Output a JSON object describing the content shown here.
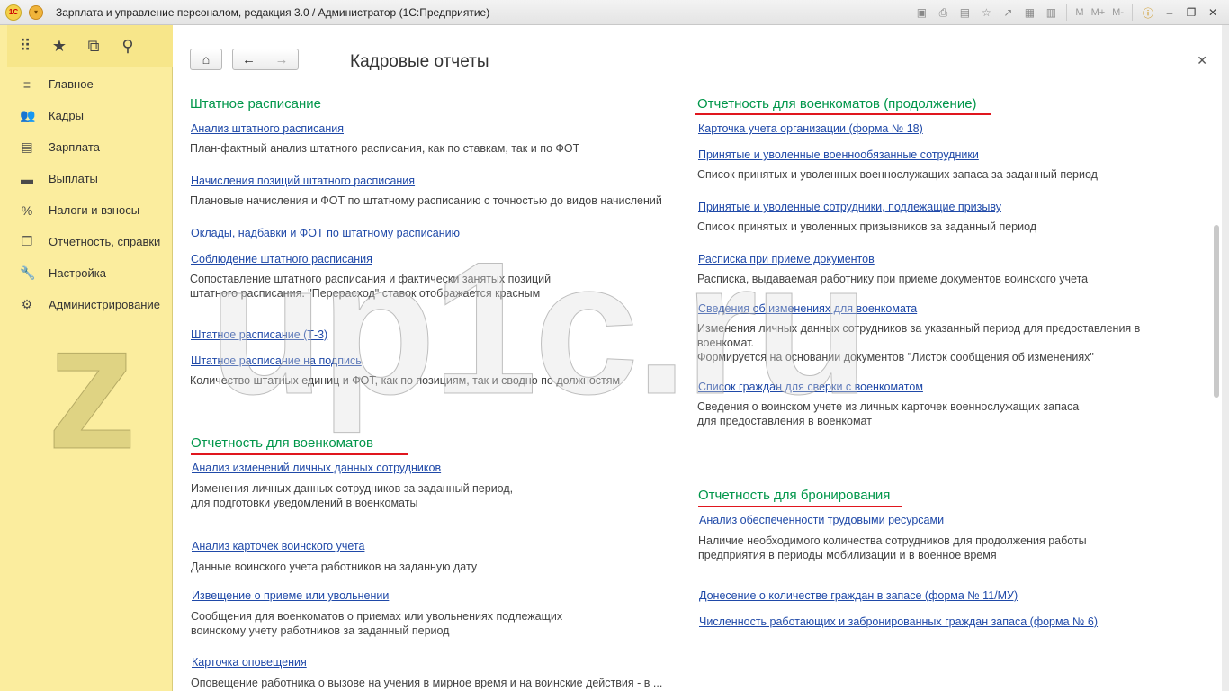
{
  "window": {
    "title": "Зарплата и управление персоналом, редакция 3.0 / Администратор  (1С:Предприятие)",
    "logo": "1С",
    "memory_labels": [
      "M",
      "M+",
      "M-"
    ]
  },
  "sidebar": {
    "items": [
      {
        "label": "Главное",
        "icon": "menu-lines-icon"
      },
      {
        "label": "Кадры",
        "icon": "people-icon"
      },
      {
        "label": "Зарплата",
        "icon": "calculator-icon"
      },
      {
        "label": "Выплаты",
        "icon": "wallet-icon"
      },
      {
        "label": "Налоги и взносы",
        "icon": "percent-icon"
      },
      {
        "label": "Отчетность, справки",
        "icon": "documents-icon"
      },
      {
        "label": "Настройка",
        "icon": "wrench-icon"
      },
      {
        "label": "Администрирование",
        "icon": "gear-icon"
      }
    ]
  },
  "page": {
    "title": "Кадровые отчеты"
  },
  "left": {
    "s1_title": "Штатное расписание",
    "l1": "Анализ штатного расписания",
    "d1": "План-фактный анализ штатного расписания, как по ставкам, так и по ФОТ",
    "l2": "Начисления позиций штатного расписания",
    "d2": "Плановые начисления и ФОТ по штатному расписанию с точностью до видов начислений",
    "l3": "Оклады, надбавки и ФОТ по штатному расписанию",
    "l4": "Соблюдение штатного расписания",
    "d4a": "Сопоставление штатного расписания и фактически занятых позиций",
    "d4b": "штатного расписания. \"Перерасход\" ставок отображается красным",
    "l5": "Штатное расписание (Т-3)",
    "l6": "Штатное расписание на подпись",
    "d6": "Количество штатных единиц и ФОТ, как по позициям, так и сводно по должностям",
    "s2_title": "Отчетность для военкоматов",
    "l7": "Анализ изменений личных данных сотрудников",
    "d7a": "Изменения личных данных сотрудников за заданный период,",
    "d7b": "для подготовки уведомлений в военкоматы",
    "l8": "Анализ карточек воинского учета",
    "d8": "Данные воинского учета работников на заданную дату",
    "l9": "Извещение о приеме или увольнении",
    "d9a": "Сообщения для военкоматов о приемах или увольнениях подлежащих",
    "d9b": "воинскому учету работников за заданный период",
    "l10": "Карточка оповещения",
    "d10": "Оповещение работника о вызове на учения в мирное время и на воинские действия - в ..."
  },
  "right": {
    "s3_title": "Отчетность для военкоматов (продолжение)",
    "l1": "Карточка учета организации (форма № 18)",
    "l2": "Принятые и уволенные военнообязанные сотрудники",
    "d2": "Список принятых и уволенных военнослужащих запаса за заданный период",
    "l3": "Принятые и уволенные сотрудники, подлежащие призыву",
    "d3": "Список принятых и уволенных призывников за заданный период",
    "l4": "Расписка при приеме документов",
    "d4": "Расписка, выдаваемая работнику при приеме документов воинского учета",
    "l5": "Сведения об изменениях для военкомата",
    "d5a": "Изменения личных данных сотрудников за указанный период для предоставления в",
    "d5b": "военкомат.",
    "d5c": "Формируется на основании документов \"Листок сообщения об изменениях\"",
    "l6": "Список граждан для сверки с военкоматом",
    "d6a": "Сведения о воинском учете из личных карточек военнослужащих запаса",
    "d6b": "для предоставления в военкомат",
    "s4_title": "Отчетность для бронирования",
    "l7": "Анализ обеспеченности трудовыми ресурсами",
    "d7a": "Наличие необходимого количества сотрудников для продолжения работы",
    "d7b": "предприятия в периоды мобилизации и в военное время",
    "l8": "Донесение о количестве граждан в запасе (форма № 11/МУ)",
    "l9": "Численность работающих и забронированных граждан запаса (форма № 6)"
  },
  "watermark": {
    "text_z": "z",
    "text_main": "up1c.ru"
  },
  "colors": {
    "section_title": "#00964a",
    "link": "#1f49a8",
    "sidebar_bg": "#fbed9e",
    "red_underline": "#e0161e"
  }
}
